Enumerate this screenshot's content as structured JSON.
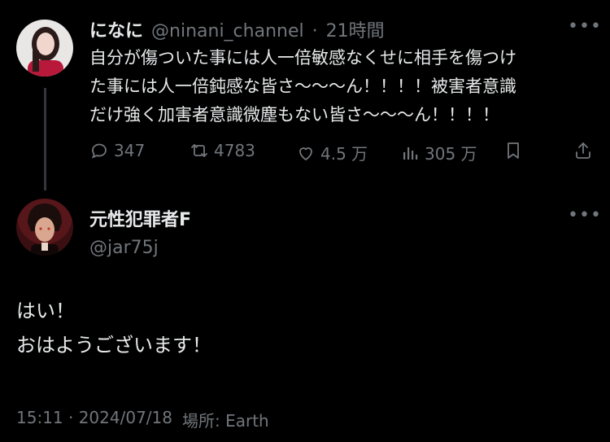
{
  "parent_post": {
    "display_name": "になに",
    "handle": "@ninani_channel",
    "separator": "·",
    "time": "21時間",
    "text_lines": [
      "自分が傷ついた事には人一倍敏感なくせに相手を傷つけ",
      "た事には人一倍鈍感な皆さ〜〜〜ん！！！！被害者意識",
      "だけ強く加害者意識微塵もない皆さ〜〜〜ん！！！！"
    ],
    "more": "•••",
    "actions": {
      "replies": "347",
      "reposts": "4783",
      "likes": "4.5 万",
      "views": "305 万"
    }
  },
  "reply_post": {
    "display_name": "元性犯罪者F",
    "handle": "@jar75j",
    "more": "•••",
    "text_lines": [
      "はい！",
      "おはようございます！"
    ],
    "timestamp": "15:11 · 2024/07/18",
    "location": "場所: Earth"
  },
  "colors": {
    "background": "#000000",
    "text": "#e7e9ea",
    "muted": "#71767b",
    "thread_line": "#333639"
  }
}
